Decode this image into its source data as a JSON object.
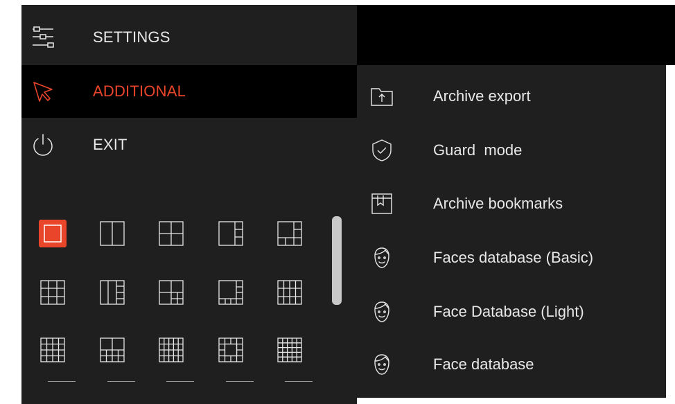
{
  "menu": {
    "settings_label": "SETTINGS",
    "additional_label": "ADDITIONAL",
    "exit_label": "EXIT",
    "icons": [
      "sliders-icon",
      "cursor-icon",
      "power-icon"
    ],
    "accent_color": "#e9452b"
  },
  "submenu": {
    "items": [
      {
        "label": "Archive export",
        "icon": "folder-upload-icon"
      },
      {
        "label": "Guard  mode",
        "icon": "shield-check-icon"
      },
      {
        "label": "Archive bookmarks",
        "icon": "bookmark-icon"
      },
      {
        "label": "Faces database (Basic)",
        "icon": "face-icon"
      },
      {
        "label": "Face Database (Light)",
        "icon": "face-icon"
      },
      {
        "label": "Face database",
        "icon": "face-icon"
      }
    ]
  },
  "layouts": {
    "selected_index": 0,
    "count": 15
  }
}
